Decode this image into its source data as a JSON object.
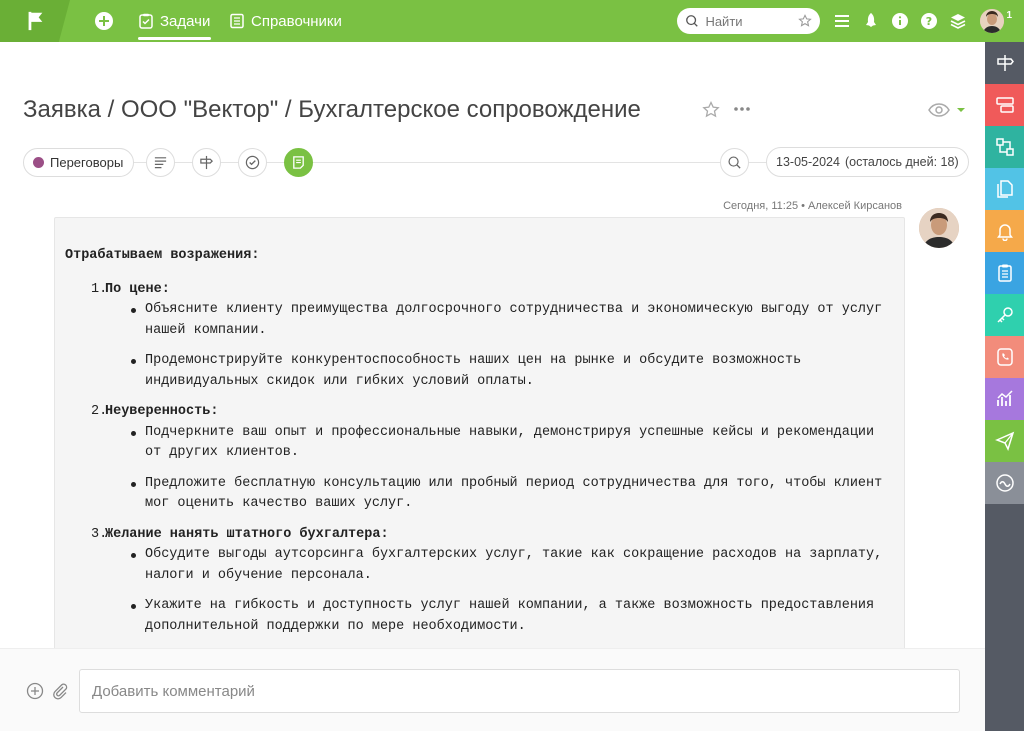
{
  "topbar": {
    "tabs": [
      {
        "label": "Задачи",
        "active": true
      },
      {
        "label": "Справочники",
        "active": false
      }
    ],
    "search_placeholder": "Найти",
    "notification_count": "1"
  },
  "task": {
    "title": "Заявка / ООО \"Вектор\" / Бухгалтерское сопровождение",
    "status": "Переговоры",
    "status_color": "#9b4f86",
    "deadline": "13-05-2024",
    "deadline_remaining": "(осталось дней: 18)"
  },
  "comment": {
    "time": "Сегодня, 11:25",
    "separator": "•",
    "author": "Алексей Кирсанов",
    "heading": "Отрабатываем возражения:",
    "sections": [
      {
        "num": "1.",
        "title": "По цене:",
        "items": [
          "Объясните клиенту преимущества долгосрочного сотрудничества и экономическую выгоду от услуг нашей компании.",
          "Продемонстрируйте конкурентоспособность наших цен на рынке и обсудите возможность индивидуальных скидок или гибких условий оплаты."
        ]
      },
      {
        "num": "2.",
        "title": "Неуверенность:",
        "items": [
          "Подчеркните ваш опыт и профессиональные навыки, демонстрируя успешные кейсы и рекомендации от других клиентов.",
          "Предложите бесплатную консультацию или пробный период сотрудничества для того, чтобы клиент мог оценить качество ваших услуг."
        ]
      },
      {
        "num": "3.",
        "title": "Желание нанять штатного бухгалтера:",
        "items": [
          "Обсудите выгоды аутсорсинга бухгалтерских услуг, такие как сокращение расходов на зарплату, налоги и обучение персонала.",
          "Укажите на гибкость и доступность услуг нашей компании, а также возможность предоставления дополнительной поддержки по мере необходимости."
        ]
      }
    ]
  },
  "composer": {
    "placeholder": "Добавить комментарий"
  },
  "colors": {
    "brand_green": "#7ac143",
    "sidebar_bg": "#555a64"
  },
  "sidebar": {
    "items": [
      {
        "icon": "sign-post-icon",
        "color": "#555a64"
      },
      {
        "icon": "layout-icon",
        "color": "#f05a5a"
      },
      {
        "icon": "hierarchy-icon",
        "color": "#2fb3a0"
      },
      {
        "icon": "documents-icon",
        "color": "#52c3e6"
      },
      {
        "icon": "bell-icon",
        "color": "#f5a94a"
      },
      {
        "icon": "clipboard-icon",
        "color": "#3aa4e2"
      },
      {
        "icon": "key-icon",
        "color": "#2fd0ae"
      },
      {
        "icon": "phone-icon",
        "color": "#f28c7b"
      },
      {
        "icon": "analytics-icon",
        "color": "#a678dd"
      },
      {
        "icon": "paper-plane-icon",
        "color": "#7ac143"
      },
      {
        "icon": "wave-icon",
        "color": "#8a8f98"
      }
    ]
  }
}
